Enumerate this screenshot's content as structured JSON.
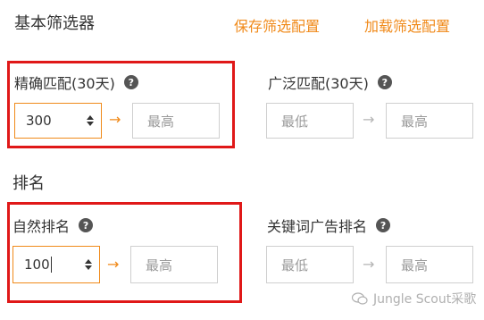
{
  "header": {
    "title": "基本筛选器",
    "save_label": "保存筛选配置",
    "load_label": "加载筛选配置"
  },
  "exact_match": {
    "label": "精确匹配(30天)",
    "help": "?",
    "min_value": "300",
    "max_placeholder": "最高"
  },
  "broad_match": {
    "label": "广泛匹配(30天)",
    "help": "?",
    "min_placeholder": "最低",
    "max_placeholder": "最高"
  },
  "ranking": {
    "section_title": "排名"
  },
  "natural_rank": {
    "label": "自然排名",
    "help": "?",
    "min_value": "100",
    "max_placeholder": "最高"
  },
  "keyword_ad_rank": {
    "label": "关键词广告排名",
    "help": "?",
    "min_placeholder": "最低",
    "max_placeholder": "最高"
  },
  "arrow_glyph": "→",
  "watermark": {
    "text": "Jungle Scout采歌"
  },
  "colors": {
    "accent": "#f08a1a",
    "highlight": "#e01818"
  }
}
